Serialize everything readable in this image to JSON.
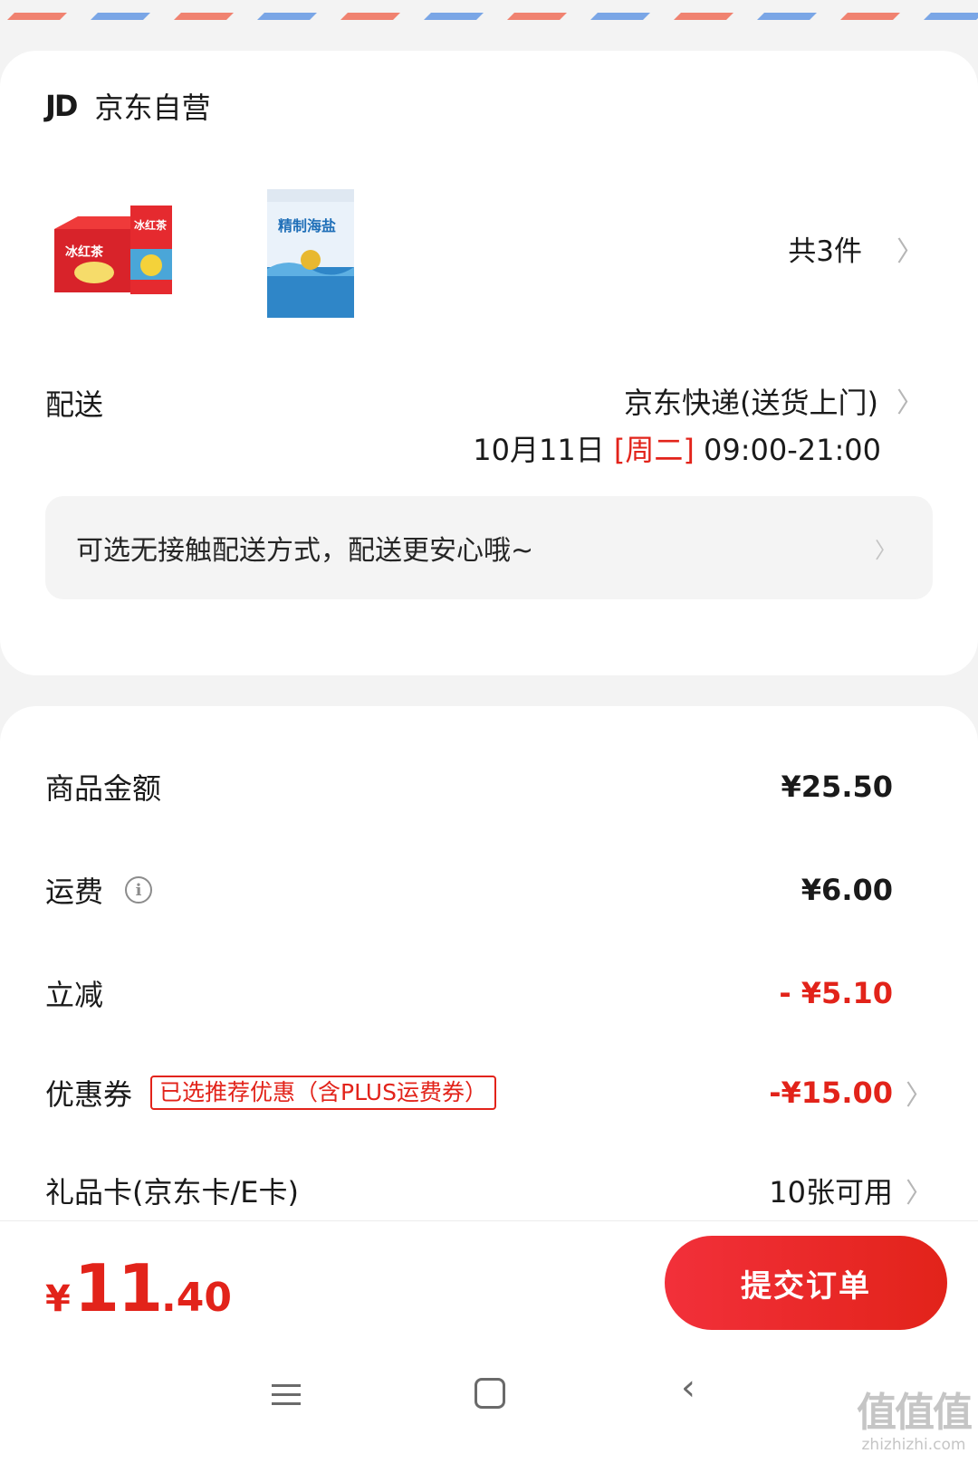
{
  "shop": {
    "logo": "JD",
    "name": "京东自营"
  },
  "products": {
    "items": [
      {
        "icon": "drink-box-product-image",
        "label": "冰红茶"
      },
      {
        "icon": "salt-bag-product-image",
        "label": "精制海盐"
      }
    ],
    "count_text": "共3件"
  },
  "delivery": {
    "label": "配送",
    "method": "京东快递(送货上门)",
    "date": "10月11日",
    "weekday": "[周二]",
    "time_slot": "09:00-21:00"
  },
  "notice": {
    "text": "可选无接触配送方式，配送更安心哦~"
  },
  "fees": {
    "goods": {
      "label": "商品金额",
      "value": "¥25.50"
    },
    "shipping": {
      "label": "运费",
      "value": "¥6.00"
    },
    "discount": {
      "label": "立减",
      "value": "- ¥5.10"
    },
    "coupon": {
      "label": "优惠券",
      "tag": "已选推荐优惠（含PLUS运费券）",
      "value": "-¥15.00"
    },
    "giftcard": {
      "label": "礼品卡(京东卡/E卡)",
      "value": "10张可用"
    }
  },
  "checkout": {
    "currency": "¥",
    "total_int": "11",
    "total_dec": ".40",
    "submit_label": "提交订单"
  },
  "watermark": {
    "logo": "值值值",
    "url": "zhizhizhi.com"
  },
  "colors": {
    "accent": "#e2231a",
    "background": "#f3f3f3"
  }
}
